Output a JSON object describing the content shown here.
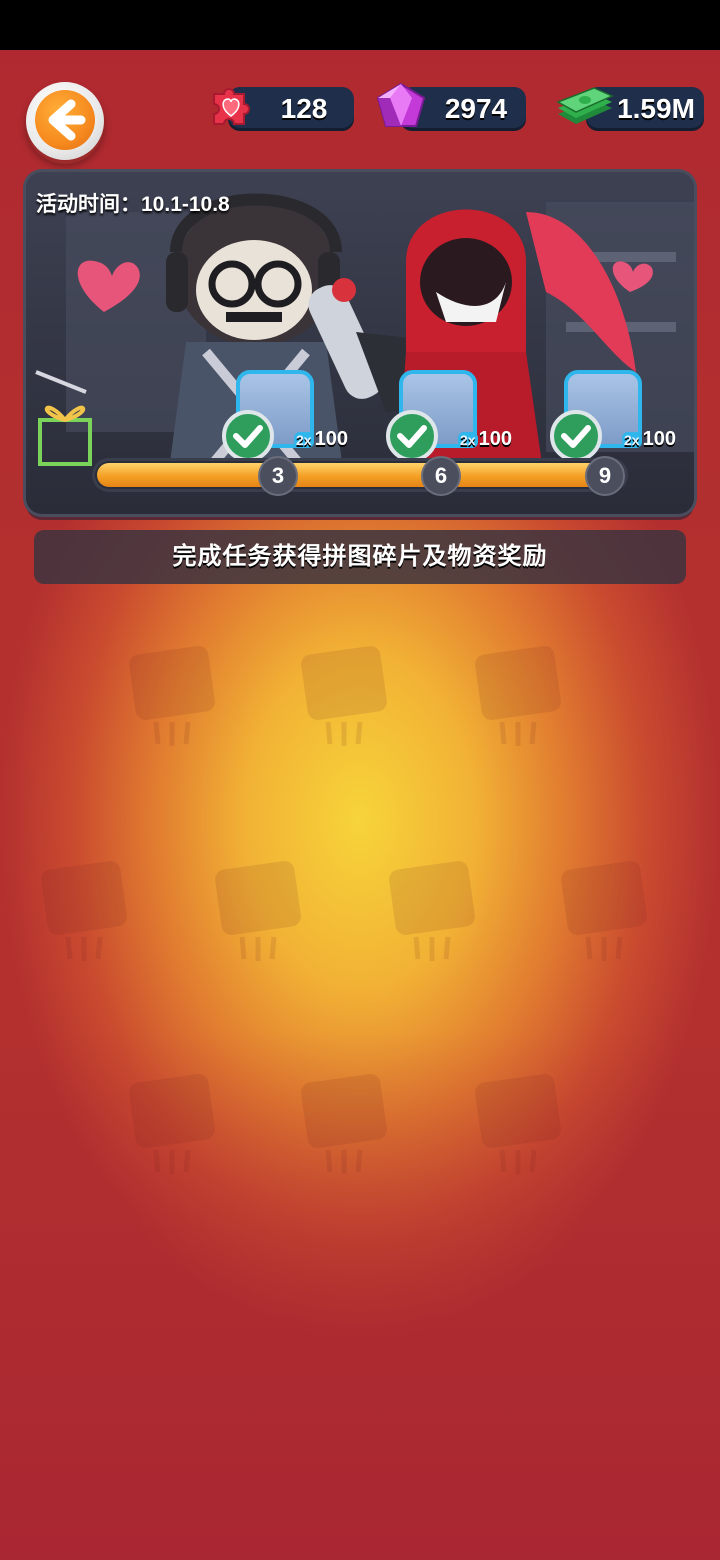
{
  "currencies": {
    "puzzle": {
      "value": "128",
      "icon": "heart-puzzle-icon"
    },
    "gems": {
      "value": "2974",
      "icon": "gem-icon"
    },
    "cash": {
      "value": "1.59M",
      "icon": "cash-stack-icon"
    }
  },
  "banner": {
    "event_time": "活动时间：10.1-10.8",
    "rewards": [
      {
        "multiplier": "2x",
        "amount": "100",
        "claimed": true
      },
      {
        "multiplier": "2x",
        "amount": "100",
        "claimed": true
      },
      {
        "multiplier": "2x",
        "amount": "100",
        "claimed": true
      }
    ],
    "milestones": [
      "3",
      "6",
      "9"
    ],
    "progress": 1.0
  },
  "description": "完成任务获得拼图碎片及物资奖励",
  "colors": {
    "background_red": "#b3302f",
    "background_yellow": "#f7d43a",
    "counter_bg": "#1f2e4a",
    "progress_orange": "#f4a025",
    "check_green": "#2f9e5d",
    "slot_border": "#2fb6ec"
  }
}
